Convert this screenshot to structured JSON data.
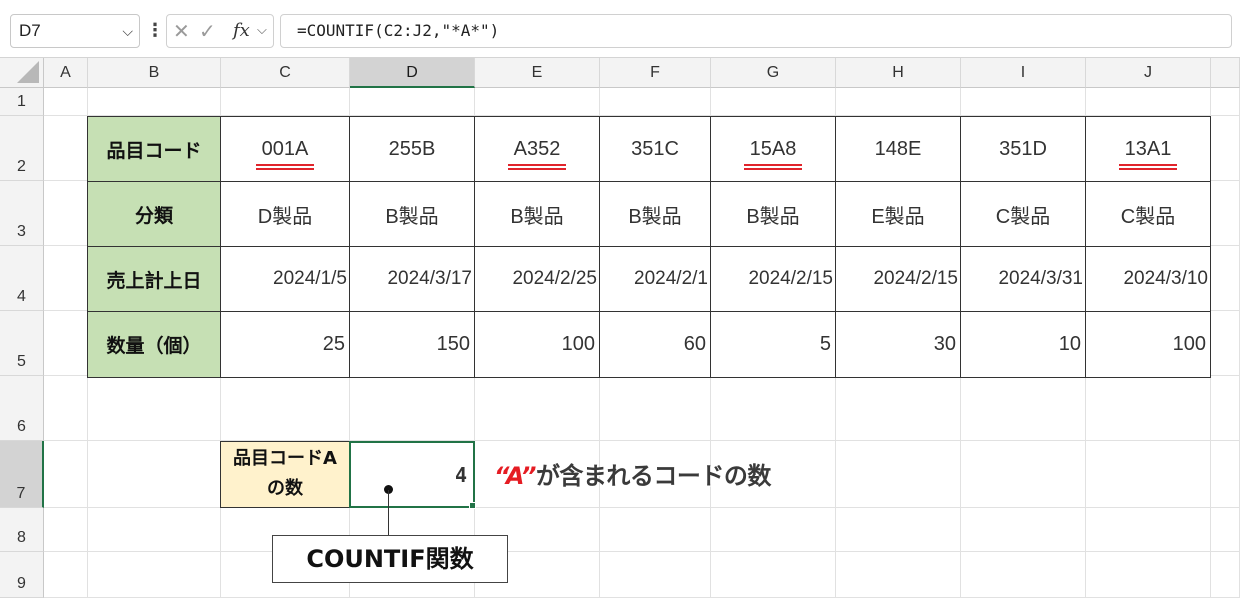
{
  "formula_bar": {
    "name_box": "D7",
    "fx": "fx",
    "formula": "=COUNTIF(C2:J2,\"*A*\")"
  },
  "columns": [
    "A",
    "B",
    "C",
    "D",
    "E",
    "F",
    "G",
    "H",
    "I",
    "J"
  ],
  "rows": [
    "1",
    "2",
    "3",
    "4",
    "5",
    "6",
    "7",
    "8",
    "9"
  ],
  "selected_cell": "D7",
  "table": {
    "row_labels": [
      "品目コード",
      "分類",
      "売上計上日",
      "数量（個）"
    ],
    "codes": [
      "001A",
      "255B",
      "A352",
      "351C",
      "15A8",
      "148E",
      "351D",
      "13A1"
    ],
    "underlined_codes": [
      true,
      false,
      true,
      false,
      true,
      false,
      false,
      true
    ],
    "categories": [
      "D製品",
      "B製品",
      "B製品",
      "B製品",
      "B製品",
      "E製品",
      "C製品",
      "C製品"
    ],
    "dates": [
      "2024/1/5",
      "2024/3/17",
      "2024/2/25",
      "2024/2/1",
      "2024/2/15",
      "2024/2/15",
      "2024/3/31",
      "2024/3/10"
    ],
    "quantities": [
      "25",
      "150",
      "100",
      "60",
      "5",
      "30",
      "10",
      "100"
    ]
  },
  "result": {
    "label_line1": "品目コードA",
    "label_line2": "の数",
    "value": "4"
  },
  "annotations": {
    "callout_red": "“A”",
    "callout_rest": "が含まれるコードの数",
    "function_box": "COUNTIF関数"
  },
  "colors": {
    "header_green": "#c6e0b4",
    "label_yellow": "#fff2cc",
    "excel_green": "#217346",
    "accent_red": "#e51c23"
  }
}
